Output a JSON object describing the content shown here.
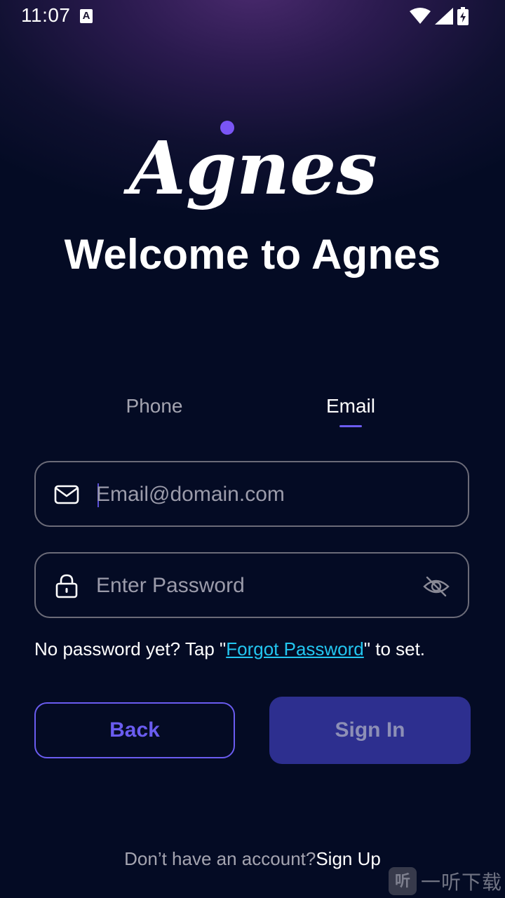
{
  "status_bar": {
    "time": "11:07",
    "notification_badge": "A",
    "icons": [
      "wifi-icon",
      "signal-icon",
      "battery-charging-icon"
    ]
  },
  "brand": {
    "logo_text": "Agnes",
    "logo_dot_color": "#7a55f5"
  },
  "welcome_title": "Welcome to Agnes",
  "tabs": [
    {
      "label": "Phone",
      "selected": false
    },
    {
      "label": "Email",
      "selected": true
    }
  ],
  "email_field": {
    "icon": "mail-icon",
    "placeholder": "Email@domain.com",
    "value": ""
  },
  "password_field": {
    "icon": "lock-icon",
    "placeholder": "Enter Password",
    "value": "",
    "visibility_icon": "eye-off-icon"
  },
  "hint": {
    "prefix": "No password yet? Tap \"",
    "link": "Forgot Password",
    "suffix": "\" to set."
  },
  "buttons": {
    "back": "Back",
    "sign_in": "Sign In"
  },
  "footer": {
    "prompt": "Don’t have an account?",
    "link": "Sign Up"
  },
  "watermark": {
    "badge": "听",
    "text": "一听下载"
  },
  "colors": {
    "accent": "#6a5cf0",
    "link": "#23c6f0",
    "sign_in_bg": "#2d2f8f",
    "background": "#040b24"
  }
}
